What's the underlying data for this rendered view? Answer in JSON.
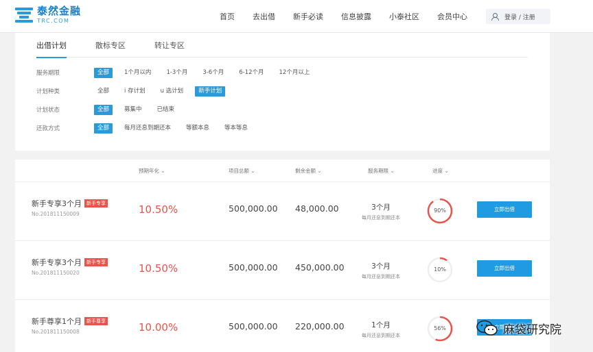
{
  "brand": {
    "name_cn": "泰然金融",
    "name_en": "TRC.COM",
    "color": "#2a9bd8"
  },
  "nav": {
    "items": [
      "首页",
      "去出借",
      "新手必读",
      "信息披露",
      "小泰社区",
      "会员中心"
    ],
    "login": "登录 / 注册",
    "login_icon": "user-icon"
  },
  "filter": {
    "tabs": [
      {
        "label": "出借计划",
        "active": true
      },
      {
        "label": "散标专区",
        "active": false
      },
      {
        "label": "转让专区",
        "active": false
      }
    ],
    "rows": [
      {
        "label": "服务期限",
        "options": [
          "全部",
          "1个月以内",
          "1-3个月",
          "3-6个月",
          "6-12个月",
          "12个月以上"
        ],
        "selected": 0
      },
      {
        "label": "计划种类",
        "options": [
          "全部",
          "i 存计划",
          "u 选计划",
          "新手计划"
        ],
        "selected": 3
      },
      {
        "label": "计划状态",
        "options": [
          "全部",
          "募集中",
          "已结束"
        ],
        "selected": 0
      },
      {
        "label": "还款方式",
        "options": [
          "全部",
          "每月还息到期还本",
          "等额本息",
          "等本等息"
        ],
        "selected": 0
      }
    ]
  },
  "list": {
    "headers": {
      "rate": "预期年化 ⌄",
      "total": "项目总额 ⌄",
      "remain": "剩余金额 ⌄",
      "term": "服务期限 ⌄",
      "progress": "进度 ⌄"
    },
    "rows": [
      {
        "name": "新手专享3个月",
        "badge": "新手专享",
        "no": "No.201811150009",
        "rate": "10.50%",
        "total": "500,000.00",
        "remain": "48,000.00",
        "term": "3个月",
        "repay": "每月还息到期还本",
        "progress_label": "90%",
        "progress": 0.9,
        "button": "立即出借"
      },
      {
        "name": "新手专享3个月",
        "badge": "新手专享",
        "no": "No.201811150020",
        "rate": "10.50%",
        "total": "500,000.00",
        "remain": "450,000.00",
        "term": "3个月",
        "repay": "每月还息到期还本",
        "progress_label": "10%",
        "progress": 0.1,
        "button": "立即出借"
      },
      {
        "name": "新手尊享1个月",
        "badge": "新手尊享",
        "no": "No.201811150008",
        "rate": "10.00%",
        "total": "500,000.00",
        "remain": "220,000.00",
        "term": "1个月",
        "repay": "每月还息到期还本",
        "progress_label": "56%",
        "progress": 0.56,
        "button": "立即出借"
      }
    ],
    "accent": "#e8534a",
    "button_color": "#1e9be3"
  },
  "watermark": {
    "text": "麻袋研究院",
    "icon": "wechat-icon"
  }
}
